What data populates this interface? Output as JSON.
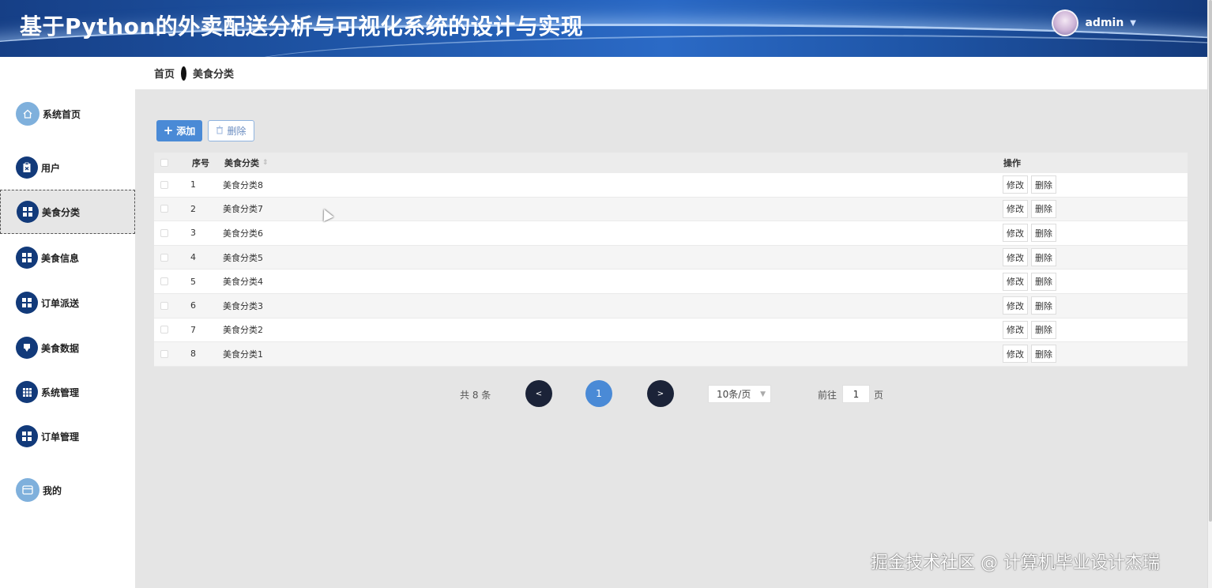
{
  "header": {
    "title": "基于Python的外卖配送分析与可视化系统的设计与实现",
    "user": "admin"
  },
  "breadcrumb": {
    "home": "首页",
    "current": "美食分类"
  },
  "sidebar": {
    "items": [
      {
        "label": "系统首页",
        "icon": "home-icon"
      },
      {
        "label": "用户",
        "icon": "clipboard-icon"
      },
      {
        "label": "美食分类",
        "icon": "grid-icon",
        "active": true
      },
      {
        "label": "美食信息",
        "icon": "grid-icon"
      },
      {
        "label": "订单派送",
        "icon": "grid-icon"
      },
      {
        "label": "美食数据",
        "icon": "pin-icon"
      },
      {
        "label": "系统管理",
        "icon": "grid9-icon"
      },
      {
        "label": "订单管理",
        "icon": "grid-icon"
      },
      {
        "label": "我的",
        "icon": "card-icon"
      }
    ]
  },
  "toolbar": {
    "add_label": "添加",
    "delete_label": "删除"
  },
  "table": {
    "headers": {
      "index": "序号",
      "category": "美食分类",
      "actions": "操作"
    },
    "rows": [
      {
        "index": "1",
        "category": "美食分类8"
      },
      {
        "index": "2",
        "category": "美食分类7"
      },
      {
        "index": "3",
        "category": "美食分类6"
      },
      {
        "index": "4",
        "category": "美食分类5"
      },
      {
        "index": "5",
        "category": "美食分类4"
      },
      {
        "index": "6",
        "category": "美食分类3"
      },
      {
        "index": "7",
        "category": "美食分类2"
      },
      {
        "index": "8",
        "category": "美食分类1"
      }
    ],
    "edit_label": "修改",
    "delete_label": "删除"
  },
  "pagination": {
    "total": "共 8 条",
    "prev": "<",
    "current": "1",
    "next": ">",
    "page_size": "10条/页",
    "goto_label": "前往",
    "goto_value": "1",
    "goto_suffix": "页"
  },
  "watermark": "掘金技术社区 @ 计算机毕业设计杰瑞",
  "colors": {
    "header": "#1f56a8",
    "primary": "#4a8ad6",
    "sidebar_icon": "#123a7a",
    "pager_dark": "#1b2338"
  }
}
